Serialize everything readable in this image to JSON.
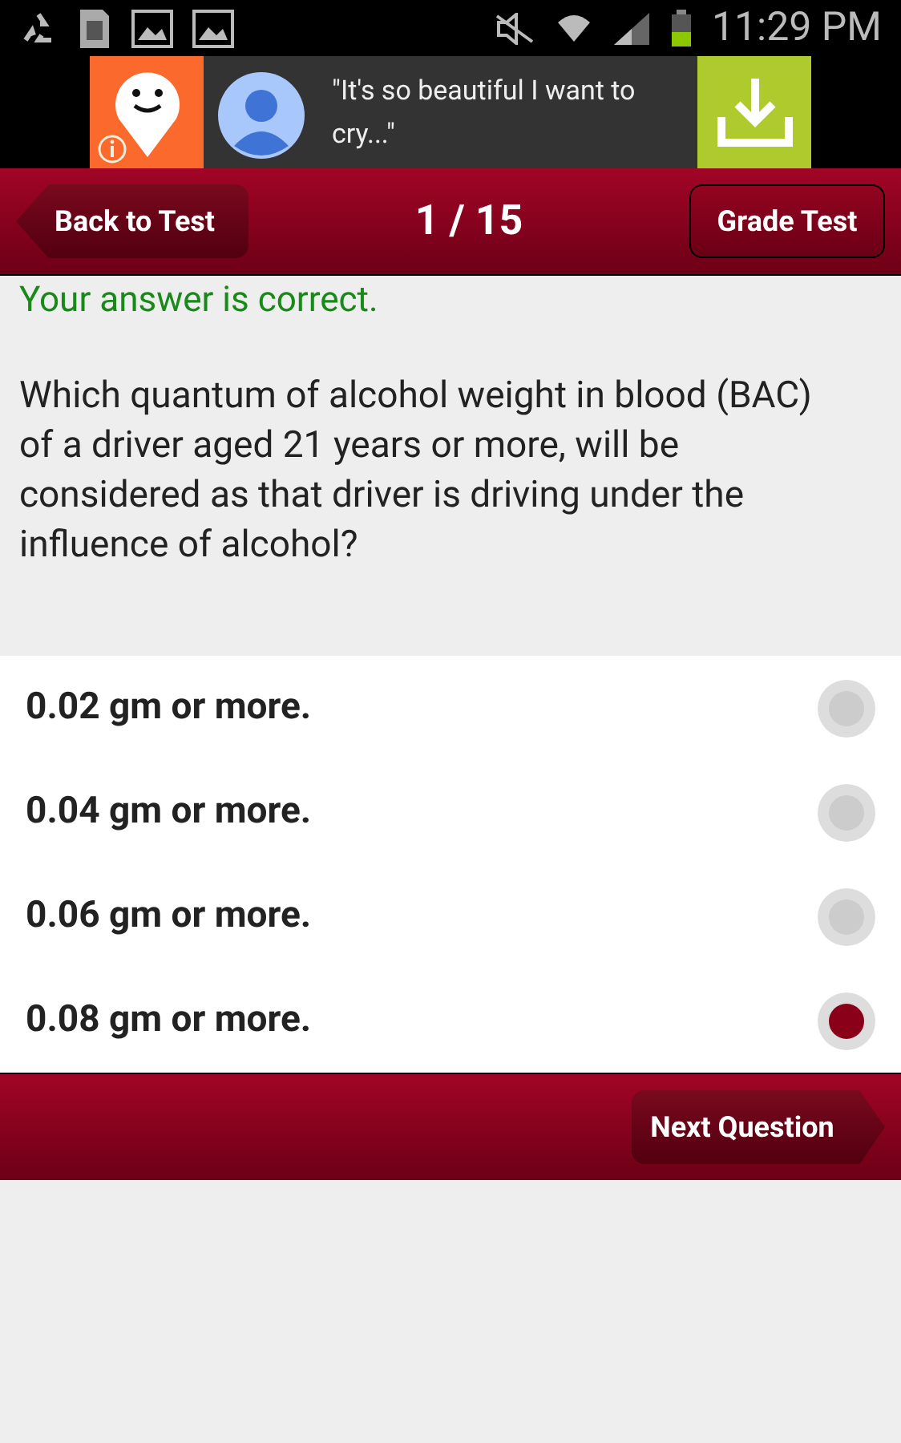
{
  "status_bar": {
    "time": "11:29 PM"
  },
  "ad": {
    "quote": "\"It's so beautiful I want to cry...\""
  },
  "header": {
    "back_button": "Back to Test",
    "progress": "1 / 15",
    "grade_button": "Grade Test"
  },
  "result": "Your answer is correct.",
  "question": "Which quantum of alcohol weight in blood (BAC) of a driver aged 21 years or more, will be considered as that driver is driving under the influence of alcohol?",
  "options": [
    {
      "label": "0.02 gm or more.",
      "selected": false
    },
    {
      "label": "0.04 gm or more.",
      "selected": false
    },
    {
      "label": "0.06 gm or more.",
      "selected": false
    },
    {
      "label": "0.08 gm or more.",
      "selected": true
    }
  ],
  "footer": {
    "next_button": "Next Question"
  }
}
